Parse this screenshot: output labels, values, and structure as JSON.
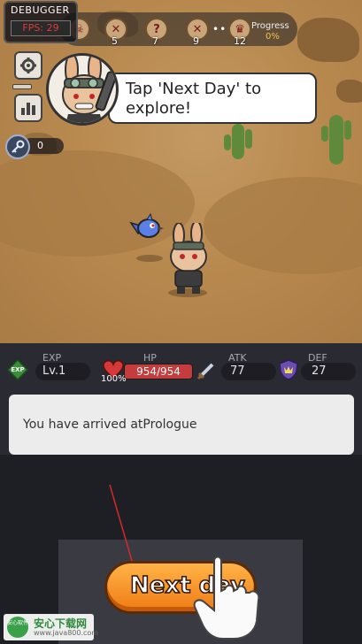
{
  "debugger": {
    "title": "DEBUGGER",
    "fps": "FPS: 29"
  },
  "stages": {
    "nodes": [
      {
        "icon": "skull-icon",
        "label": ""
      },
      {
        "icon": "crossed-swords-icon",
        "label": "5"
      },
      {
        "icon": "question-icon",
        "label": "7"
      },
      {
        "icon": "crossed-swords-icon",
        "label": "9"
      },
      {
        "icon": "boss-icon",
        "label": "12"
      }
    ],
    "dots": "•••",
    "progress_label": "Progress",
    "progress_value": "0%"
  },
  "keys": {
    "count": "0"
  },
  "dialog": {
    "text": "Tap 'Next Day' to explore!"
  },
  "stats": {
    "exp_label": "EXP",
    "exp_icon_text": "EXP",
    "level": "Lv.1",
    "hp_label": "HP",
    "hp_value": "954/954",
    "hp_fraction": 1.0,
    "hp_percent": "100%",
    "atk_label": "ATK",
    "atk_value": "77",
    "def_label": "DEF",
    "def_value": "27"
  },
  "log": {
    "message": "You have arrived atPrologue"
  },
  "next_button": {
    "label": "Next day"
  },
  "watermark": {
    "main": "安心下载网",
    "sub": "www.java800.com",
    "logo": "安心软件"
  },
  "colors": {
    "accent": "#f07b14",
    "hp": "#c43c3c",
    "fps": "#e03a3a"
  }
}
